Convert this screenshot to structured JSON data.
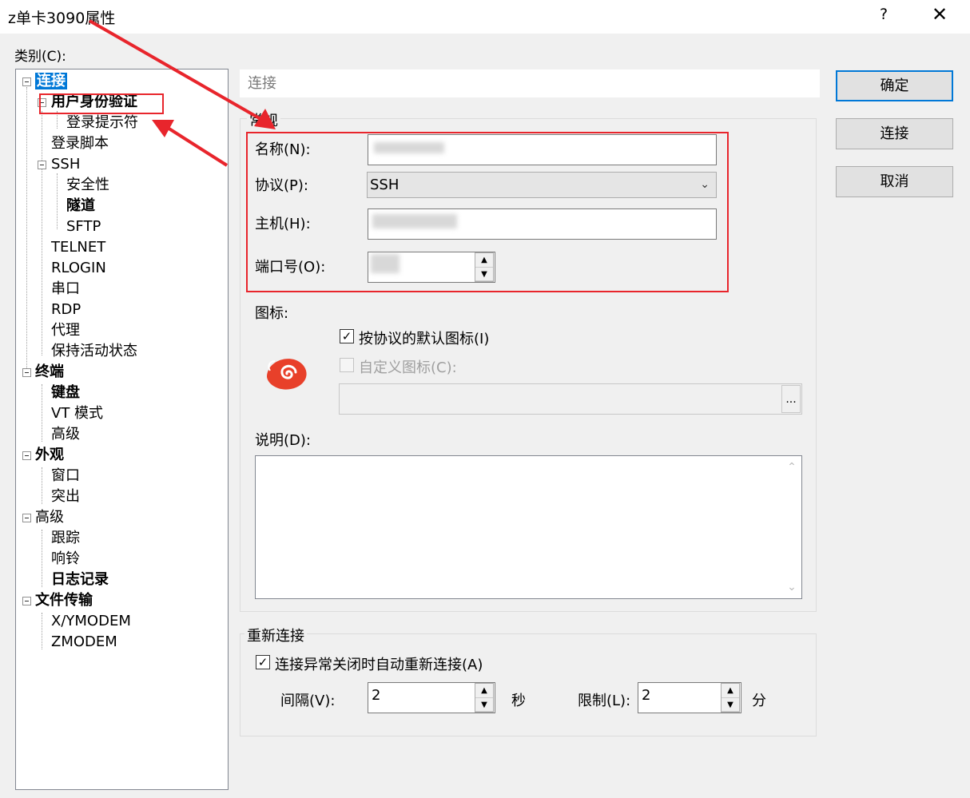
{
  "window": {
    "title": "z单卡3090属性",
    "help": "?",
    "close": "✕"
  },
  "category_label": "类别(C):",
  "tree": [
    {
      "label": "连接",
      "bold": true,
      "selected": true
    },
    {
      "label": "用户身份验证",
      "bold": true
    },
    {
      "label": "登录提示符"
    },
    {
      "label": "登录脚本"
    },
    {
      "label": "SSH"
    },
    {
      "label": "安全性"
    },
    {
      "label": "隧道",
      "bold": true
    },
    {
      "label": "SFTP"
    },
    {
      "label": "TELNET"
    },
    {
      "label": "RLOGIN"
    },
    {
      "label": "串口"
    },
    {
      "label": "RDP"
    },
    {
      "label": "代理"
    },
    {
      "label": "保持活动状态"
    },
    {
      "label": "终端",
      "bold": true
    },
    {
      "label": "键盘",
      "bold": true
    },
    {
      "label": "VT 模式"
    },
    {
      "label": "高级"
    },
    {
      "label": "外观",
      "bold": true
    },
    {
      "label": "窗口"
    },
    {
      "label": "突出"
    },
    {
      "label": "高级"
    },
    {
      "label": "跟踪"
    },
    {
      "label": "响铃"
    },
    {
      "label": "日志记录",
      "bold": true
    },
    {
      "label": "文件传输",
      "bold": true
    },
    {
      "label": "X/YMODEM"
    },
    {
      "label": "ZMODEM"
    }
  ],
  "panel": {
    "header": "连接",
    "general_group": "常规",
    "name_label": "名称(N):",
    "name_value": "",
    "protocol_label": "协议(P):",
    "protocol_value": "SSH",
    "host_label": "主机(H):",
    "host_value": "",
    "port_label": "端口号(O):",
    "port_value": "",
    "icon_label": "图标:",
    "default_icon_label": "按协议的默认图标(I)",
    "default_icon_checked": true,
    "custom_icon_label": "自定义图标(C):",
    "custom_icon_checked": false,
    "browse_label": "...",
    "description_label": "说明(D):",
    "description_value": ""
  },
  "reconnect": {
    "group_title": "重新连接",
    "auto_label": "连接异常关闭时自动重新连接(A)",
    "auto_checked": true,
    "interval_label": "间隔(V):",
    "interval_value": "2",
    "interval_unit": "秒",
    "limit_label": "限制(L):",
    "limit_value": "2",
    "limit_unit": "分"
  },
  "buttons": {
    "ok": "确定",
    "connect": "连接",
    "cancel": "取消"
  },
  "colors": {
    "selection": "#0078d7",
    "annotation_red": "#e8252c",
    "app_icon": "#e8402a"
  }
}
